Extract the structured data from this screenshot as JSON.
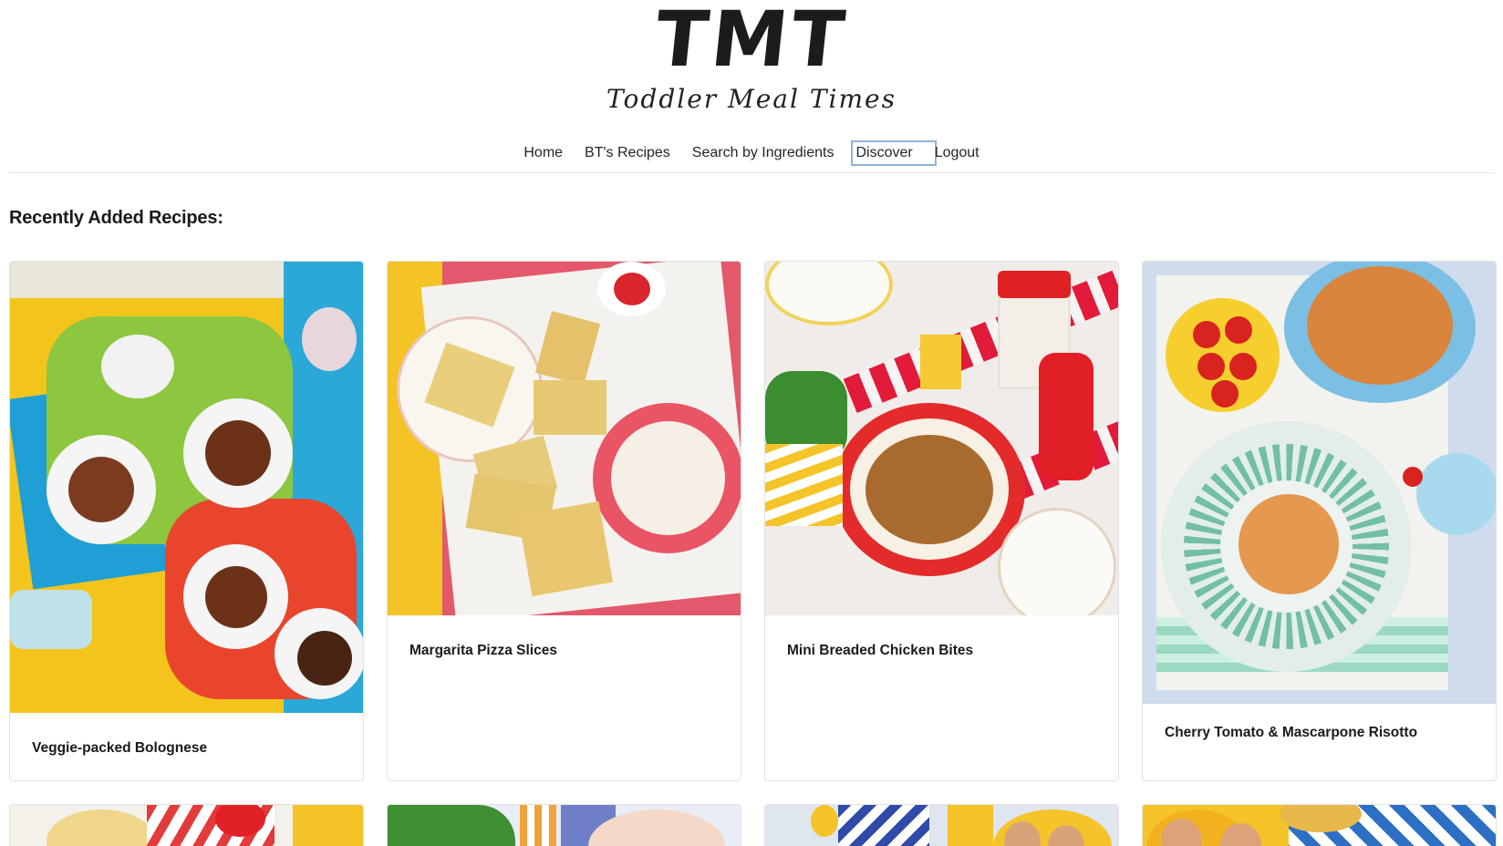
{
  "site": {
    "logo": "TMT",
    "tagline": "Toddler Meal Times"
  },
  "nav": {
    "items": [
      {
        "label": "Home"
      },
      {
        "label": "BT's Recipes"
      },
      {
        "label": "Search by Ingredients"
      },
      {
        "label": "Discover"
      },
      {
        "label": "Logout"
      }
    ]
  },
  "section": {
    "title": "Recently Added Recipes:"
  },
  "recipes": [
    {
      "title": "Veggie-packed Bolognese"
    },
    {
      "title": "Margarita Pizza Slices"
    },
    {
      "title": "Mini Breaded Chicken Bites"
    },
    {
      "title": "Cherry Tomato & Mascarpone Risotto"
    }
  ]
}
